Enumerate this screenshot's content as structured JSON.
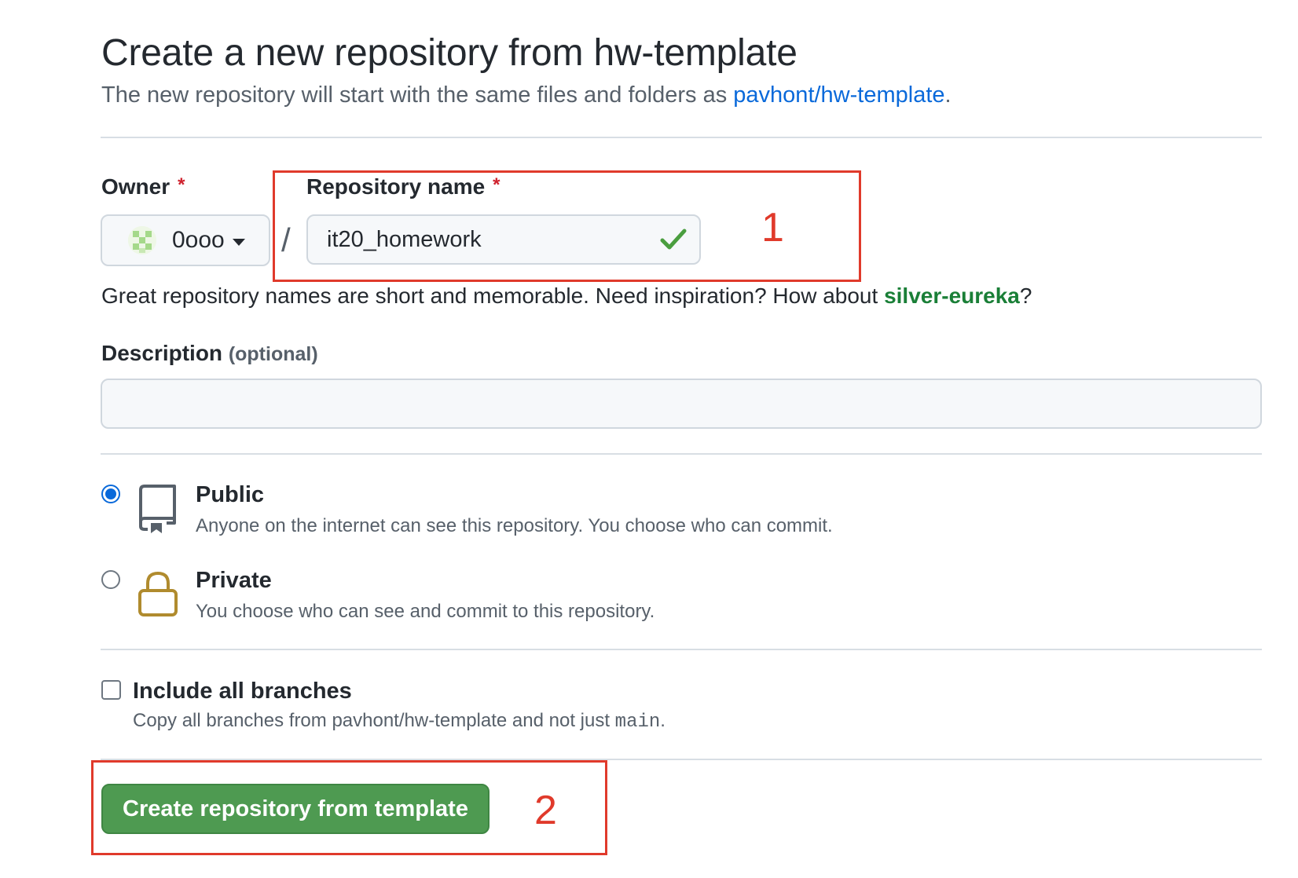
{
  "header": {
    "title": "Create a new repository from hw-template",
    "subtitle_prefix": "The new repository will start with the same files and folders as ",
    "template_link": "pavhont/hw-template",
    "subtitle_suffix": "."
  },
  "owner": {
    "label": "Owner",
    "required_mark": "*",
    "selected": "0ooo"
  },
  "repo_name": {
    "label": "Repository name",
    "required_mark": "*",
    "value": "it20_homework",
    "separator": "/"
  },
  "hint": {
    "prefix": "Great repository names are short and memorable. Need inspiration? How about ",
    "suggestion": "silver-eureka",
    "suffix": "?"
  },
  "description": {
    "label": "Description",
    "optional": "(optional)",
    "value": ""
  },
  "visibility": {
    "public": {
      "title": "Public",
      "desc": "Anyone on the internet can see this repository. You choose who can commit.",
      "checked": true
    },
    "private": {
      "title": "Private",
      "desc": "You choose who can see and commit to this repository.",
      "checked": false
    }
  },
  "branches": {
    "label": "Include all branches",
    "desc_prefix": "Copy all branches from pavhont/hw-template and not just ",
    "desc_code": "main",
    "desc_suffix": ".",
    "checked": false
  },
  "submit": {
    "label": "Create repository from template"
  },
  "annotations": {
    "first": "1",
    "second": "2"
  },
  "colors": {
    "link": "#0969da",
    "suggestion": "#1a7f37",
    "button": "#4e9a51",
    "annotation": "#e03a2b",
    "check": "#4a9e3f",
    "lock": "#b08b2e"
  },
  "icons": {
    "owner_avatar": "avatar-icon",
    "owner_dropdown": "caret-down-icon",
    "name_valid": "check-icon",
    "public": "repo-icon",
    "private": "lock-icon"
  }
}
